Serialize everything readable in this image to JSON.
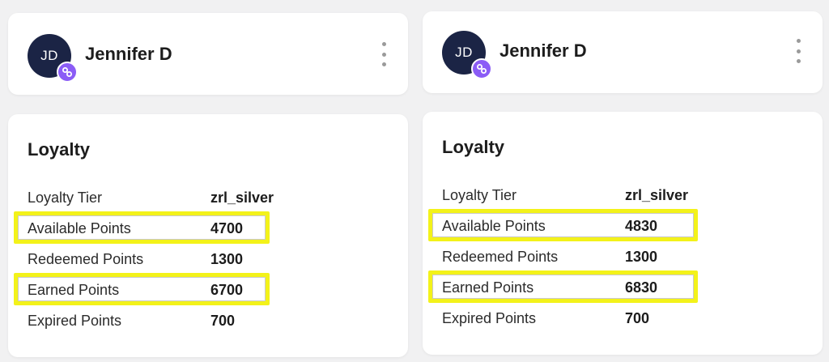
{
  "colors": {
    "avatar_bg": "#1b2445",
    "badge_bg": "#8b5cf6",
    "highlight": "#f3f21a",
    "page_bg": "#f1f1f2"
  },
  "panels": [
    {
      "header": {
        "initials": "JD",
        "name": "Jennifer D",
        "badge_icon": "link-icon",
        "menu_icon": "more-vertical-icon"
      },
      "loyalty": {
        "title": "Loyalty",
        "rows": [
          {
            "label": "Loyalty Tier",
            "value": "zrl_silver",
            "highlighted": false
          },
          {
            "label": "Available Points",
            "value": "4700",
            "highlighted": true
          },
          {
            "label": "Redeemed Points",
            "value": "1300",
            "highlighted": false
          },
          {
            "label": "Earned Points",
            "value": "6700",
            "highlighted": true
          },
          {
            "label": "Expired Points",
            "value": "700",
            "highlighted": false
          }
        ]
      }
    },
    {
      "header": {
        "initials": "JD",
        "name": "Jennifer D",
        "badge_icon": "link-icon",
        "menu_icon": "more-vertical-icon"
      },
      "loyalty": {
        "title": "Loyalty",
        "rows": [
          {
            "label": "Loyalty Tier",
            "value": "zrl_silver",
            "highlighted": false
          },
          {
            "label": "Available Points",
            "value": "4830",
            "highlighted": true
          },
          {
            "label": "Redeemed Points",
            "value": "1300",
            "highlighted": false
          },
          {
            "label": "Earned Points",
            "value": "6830",
            "highlighted": true
          },
          {
            "label": "Expired Points",
            "value": "700",
            "highlighted": false
          }
        ]
      }
    }
  ]
}
